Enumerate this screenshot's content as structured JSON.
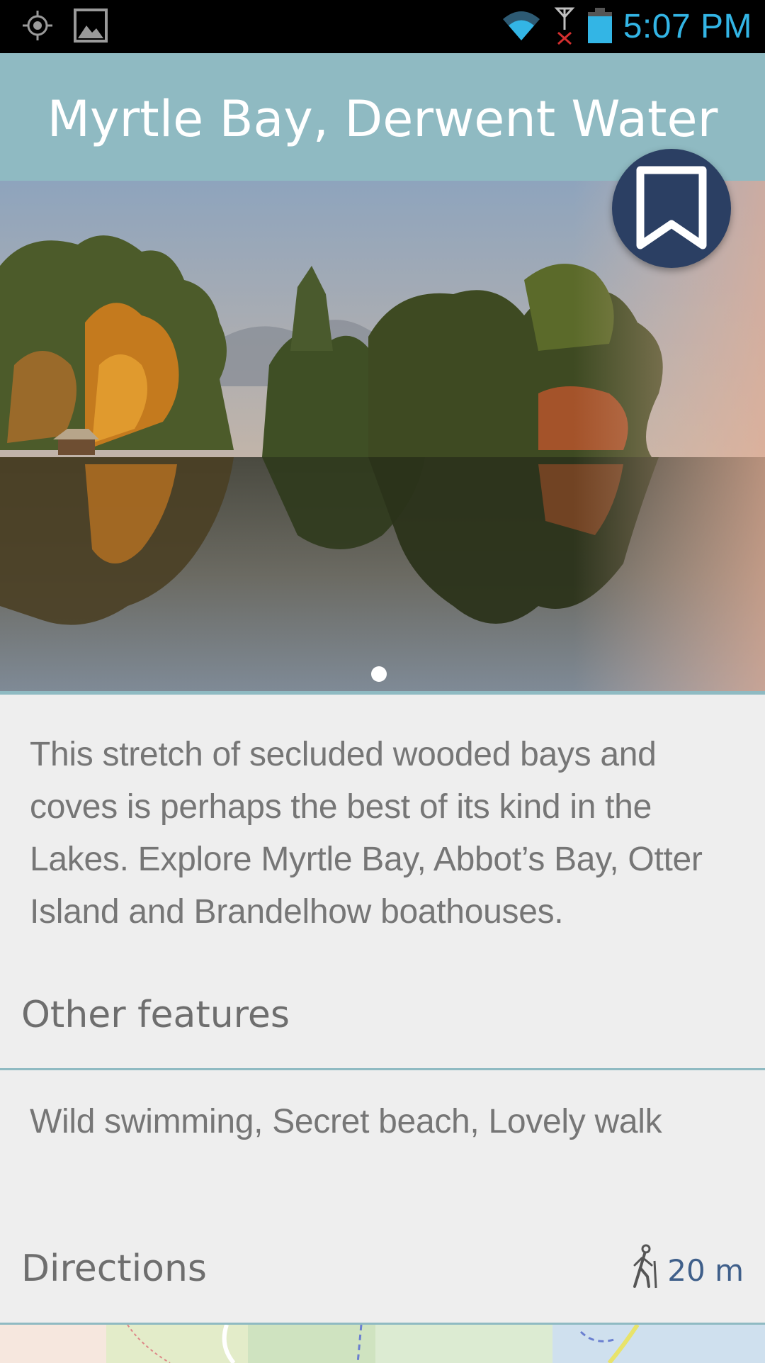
{
  "status_bar": {
    "time": "5:07 PM",
    "icons": [
      "location-icon",
      "gallery-icon",
      "wifi-icon",
      "signal-icon",
      "battery-icon"
    ]
  },
  "header": {
    "title": "Myrtle Bay, Derwent Water"
  },
  "hero": {
    "page_indicator": {
      "current": 1,
      "total": 1
    }
  },
  "description": "This stretch of secluded wooded bays and coves is perhaps the best of its kind in the Lakes. Explore Myrtle Bay, Abbot’s Bay, Otter Island and Brandelhow boathouses.",
  "other_features": {
    "title": "Other features",
    "text": "Wild swimming, Secret beach, Lovely walk"
  },
  "directions": {
    "title": "Directions",
    "distance": "20 m"
  },
  "colors": {
    "header_bg": "#8fbac2",
    "fab_bg": "#2b3f63",
    "time_blue": "#33b5e5",
    "page_bg": "#eeeeee"
  }
}
